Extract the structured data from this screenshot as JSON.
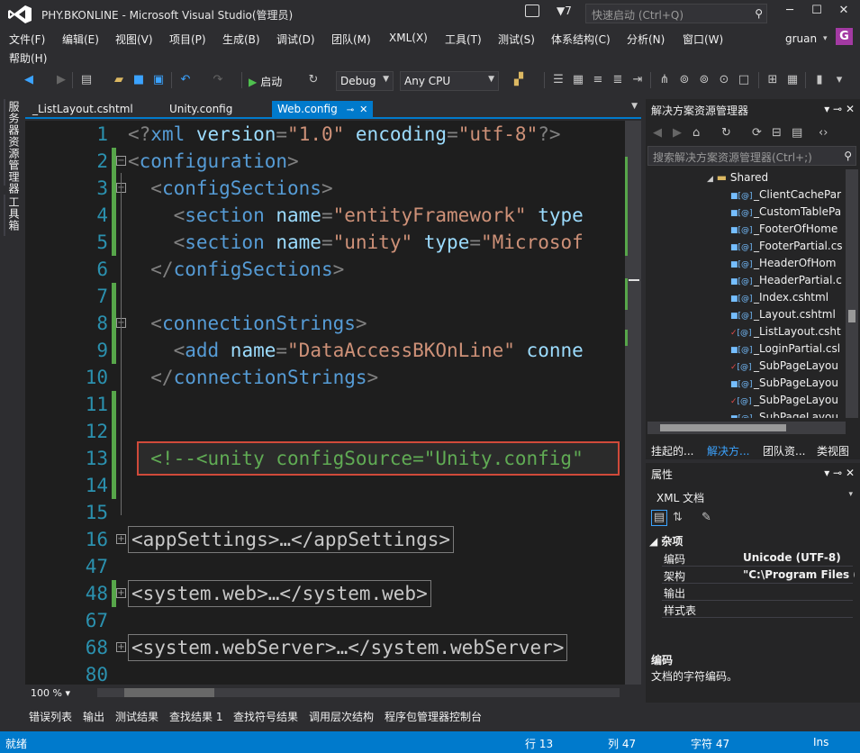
{
  "window": {
    "title": "PHY.BKONLINE - Microsoft Visual Studio(管理员)",
    "notification_count": "7",
    "quick_launch_placeholder": "快速启动 (Ctrl+Q)",
    "user": "gruan",
    "avatar_letter": "G"
  },
  "menu": [
    "文件(F)",
    "编辑(E)",
    "视图(V)",
    "项目(P)",
    "生成(B)",
    "调试(D)",
    "团队(M)",
    "XML(X)",
    "工具(T)",
    "测试(S)",
    "体系结构(C)",
    "分析(N)",
    "窗口(W)",
    "帮助(H)"
  ],
  "toolbar": {
    "start_label": "启动",
    "config": "Debug",
    "platform": "Any CPU"
  },
  "left_tabs": [
    "服务器资源管理器",
    "工具箱"
  ],
  "doc_tabs": [
    {
      "label": "_ListLayout.cshtml",
      "active": false
    },
    {
      "label": "Unity.config",
      "active": false
    },
    {
      "label": "Web.config",
      "active": true
    }
  ],
  "editor": {
    "lines": [
      {
        "num": "1",
        "collapsed": false,
        "tokens": [
          [
            "punct",
            "<?"
          ],
          [
            "tag",
            "xml "
          ],
          [
            "attr",
            "version"
          ],
          [
            "punct",
            "="
          ],
          [
            "val",
            "\"1.0\""
          ],
          [
            "attr",
            " encoding"
          ],
          [
            "punct",
            "="
          ],
          [
            "val",
            "\"utf-8\""
          ],
          [
            "punct",
            "?>"
          ]
        ]
      },
      {
        "num": "2",
        "collapsed": false,
        "tokens": [
          [
            "punct",
            "<"
          ],
          [
            "tag",
            "configuration"
          ],
          [
            "punct",
            ">"
          ]
        ]
      },
      {
        "num": "3",
        "collapsed": false,
        "tokens": [
          [
            "punct",
            "  <"
          ],
          [
            "tag",
            "configSections"
          ],
          [
            "punct",
            ">"
          ]
        ]
      },
      {
        "num": "4",
        "collapsed": false,
        "tokens": [
          [
            "punct",
            "    <"
          ],
          [
            "tag",
            "section "
          ],
          [
            "attr",
            "name"
          ],
          [
            "punct",
            "="
          ],
          [
            "val",
            "\"entityFramework\""
          ],
          [
            "attr",
            " type"
          ]
        ]
      },
      {
        "num": "5",
        "collapsed": false,
        "tokens": [
          [
            "punct",
            "    <"
          ],
          [
            "tag",
            "section "
          ],
          [
            "attr",
            "name"
          ],
          [
            "punct",
            "="
          ],
          [
            "val",
            "\"unity\""
          ],
          [
            "attr",
            " type"
          ],
          [
            "punct",
            "="
          ],
          [
            "val",
            "\"Microsof"
          ]
        ]
      },
      {
        "num": "6",
        "collapsed": false,
        "tokens": [
          [
            "punct",
            "  </"
          ],
          [
            "tag",
            "configSections"
          ],
          [
            "punct",
            ">"
          ]
        ]
      },
      {
        "num": "7",
        "collapsed": false,
        "tokens": []
      },
      {
        "num": "8",
        "collapsed": false,
        "tokens": [
          [
            "punct",
            "  <"
          ],
          [
            "tag",
            "connectionStrings"
          ],
          [
            "punct",
            ">"
          ]
        ]
      },
      {
        "num": "9",
        "collapsed": false,
        "tokens": [
          [
            "punct",
            "    <"
          ],
          [
            "tag",
            "add "
          ],
          [
            "attr",
            "name"
          ],
          [
            "punct",
            "="
          ],
          [
            "val",
            "\"DataAccessBKOnLine\""
          ],
          [
            "attr",
            " conne"
          ]
        ]
      },
      {
        "num": "10",
        "collapsed": false,
        "tokens": [
          [
            "punct",
            "  </"
          ],
          [
            "tag",
            "connectionStrings"
          ],
          [
            "punct",
            ">"
          ]
        ]
      },
      {
        "num": "11",
        "collapsed": false,
        "tokens": []
      },
      {
        "num": "12",
        "collapsed": false,
        "tokens": []
      },
      {
        "num": "13",
        "collapsed": false,
        "tokens": [
          [
            "comment",
            "  <!--<unity configSource=\"Unity.config\""
          ]
        ]
      },
      {
        "num": "14",
        "collapsed": false,
        "tokens": []
      },
      {
        "num": "15",
        "collapsed": false,
        "tokens": []
      },
      {
        "num": "16",
        "collapsed": true,
        "tokens": [
          [
            "text",
            "<appSettings>…</appSettings>"
          ]
        ]
      },
      {
        "num": "47",
        "collapsed": false,
        "tokens": []
      },
      {
        "num": "48",
        "collapsed": true,
        "tokens": [
          [
            "text",
            "<system.web>…</system.web>"
          ]
        ]
      },
      {
        "num": "67",
        "collapsed": false,
        "tokens": []
      },
      {
        "num": "68",
        "collapsed": true,
        "tokens": [
          [
            "text",
            "<system.webServer>…</system.webServer>"
          ]
        ]
      },
      {
        "num": "80",
        "collapsed": false,
        "tokens": []
      }
    ],
    "zoom": "100 %"
  },
  "solution_explorer": {
    "title": "解决方案资源管理器",
    "search_placeholder": "搜索解决方案资源管理器(Ctrl+;)",
    "folder": "Shared",
    "files": [
      {
        "name": "_ClientCachePar",
        "checked": false
      },
      {
        "name": "_CustomTablePa",
        "checked": false
      },
      {
        "name": "_FooterOfHome",
        "checked": false
      },
      {
        "name": "_FooterPartial.cs",
        "checked": false
      },
      {
        "name": "_HeaderOfHom",
        "checked": false
      },
      {
        "name": "_HeaderPartial.c",
        "checked": false
      },
      {
        "name": "_Index.cshtml",
        "checked": false
      },
      {
        "name": "_Layout.cshtml",
        "checked": false
      },
      {
        "name": "_ListLayout.csht",
        "checked": true
      },
      {
        "name": "_LoginPartial.csl",
        "checked": false
      },
      {
        "name": "_SubPageLayou",
        "checked": true
      },
      {
        "name": "_SubPageLayou",
        "checked": false
      },
      {
        "name": "_SubPageLayou",
        "checked": true
      },
      {
        "name": "_SubPageLayou",
        "checked": false
      }
    ],
    "tabs": [
      "挂起的...",
      "解决方...",
      "团队资...",
      "类视图"
    ]
  },
  "properties": {
    "title": "属性",
    "selector": "XML 文档",
    "category": "杂项",
    "rows": [
      {
        "name": "编码",
        "value": "Unicode (UTF-8)"
      },
      {
        "name": "架构",
        "value": "\"C:\\Program Files (x"
      },
      {
        "name": "输出",
        "value": ""
      },
      {
        "name": "样式表",
        "value": ""
      }
    ],
    "desc_title": "编码",
    "desc_text": "文档的字符编码。"
  },
  "bottom_tabs": [
    "错误列表",
    "输出",
    "测试结果",
    "查找结果 1",
    "查找符号结果",
    "调用层次结构",
    "程序包管理器控制台"
  ],
  "status": {
    "ready": "就绪",
    "row": "行 13",
    "col": "列 47",
    "char": "字符 47",
    "mode": "Ins"
  }
}
